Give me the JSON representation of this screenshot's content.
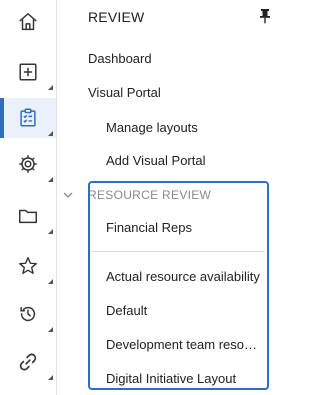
{
  "panel": {
    "title": "REVIEW",
    "links": [
      "Dashboard",
      "Visual Portal"
    ],
    "sublinks": [
      "Manage layouts",
      "Add Visual Portal"
    ]
  },
  "section": {
    "title": "RESOURCE REVIEW"
  },
  "layouts": {
    "pinned": "Financial Reps",
    "items": [
      "Actual resource availability",
      "Default",
      "Development team resourc...",
      "Digital Initiative Layout"
    ]
  },
  "rail": {
    "icons": [
      "home-icon",
      "add-icon",
      "review-icon",
      "settings-icon",
      "folder-icon",
      "star-icon",
      "history-icon",
      "link-icon"
    ],
    "active": "review-icon"
  },
  "colors": {
    "accent": "#2f6dc2",
    "active_bg": "#eaf1fb",
    "muted": "#8a8a8a"
  }
}
